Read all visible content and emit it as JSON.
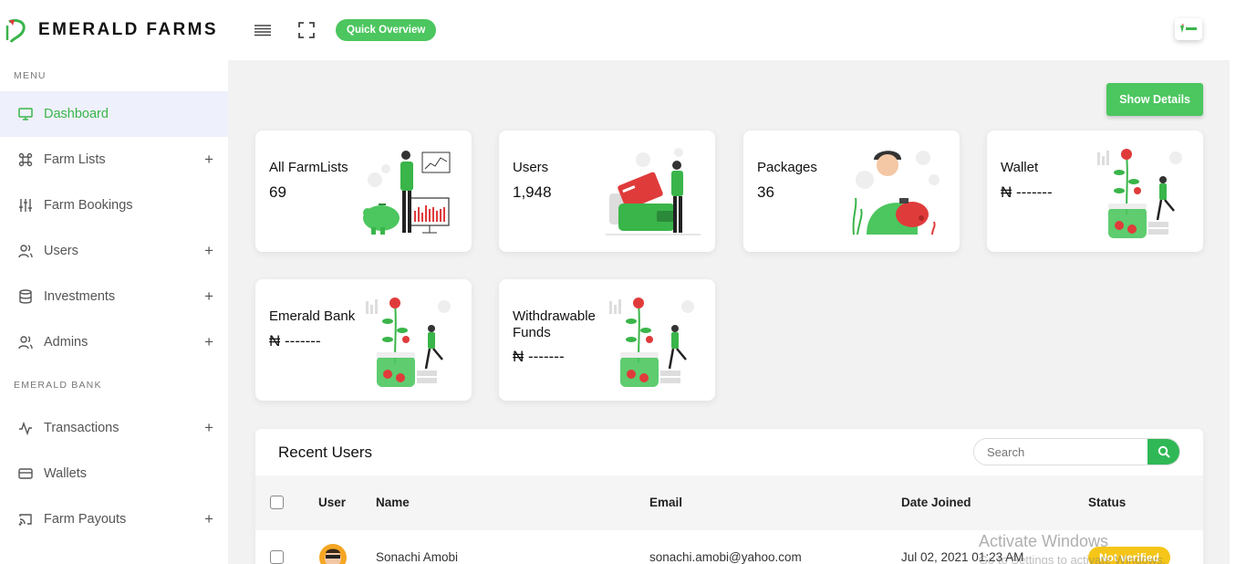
{
  "brand": {
    "name": "EMERALD FARMS"
  },
  "topbar": {
    "quick_overview": "Quick Overview"
  },
  "sidebar": {
    "menu_title": "MENU",
    "items": [
      {
        "label": "Dashboard",
        "icon": "monitor-icon",
        "active": true
      },
      {
        "label": "Farm Lists",
        "icon": "command-icon",
        "plus": "+"
      },
      {
        "label": "Farm Bookings",
        "icon": "sliders-icon"
      },
      {
        "label": "Users",
        "icon": "users-icon",
        "plus": "+"
      },
      {
        "label": "Investments",
        "icon": "database-icon",
        "plus": "+"
      },
      {
        "label": "Admins",
        "icon": "users-icon",
        "plus": "+"
      }
    ],
    "bank_title": "EMERALD BANK",
    "bank_items": [
      {
        "label": "Transactions",
        "icon": "activity-icon",
        "plus": "+"
      },
      {
        "label": "Wallets",
        "icon": "credit-card-icon"
      },
      {
        "label": "Farm Payouts",
        "icon": "cast-icon",
        "plus": "+"
      }
    ]
  },
  "main": {
    "show_details": "Show Details",
    "cards": [
      {
        "title": "All FarmLists",
        "value": "69"
      },
      {
        "title": "Users",
        "value": "1,948"
      },
      {
        "title": "Packages",
        "value": "36"
      },
      {
        "title": "Wallet",
        "value": "₦ -------"
      },
      {
        "title": "Emerald Bank",
        "value": "₦ -------"
      },
      {
        "title": "Withdrawable Funds",
        "value": "₦ -------"
      }
    ]
  },
  "recent_users": {
    "title": "Recent Users",
    "search_placeholder": "Search",
    "columns": [
      "User",
      "Name",
      "Email",
      "Date Joined",
      "Status"
    ],
    "rows": [
      {
        "name": "Sonachi Amobi",
        "email": "sonachi.amobi@yahoo.com",
        "date_joined": "Jul 02, 2021 01:23 AM",
        "status": "Not verified"
      }
    ]
  },
  "watermark": {
    "line1": "Activate Windows",
    "line2": "Go to Settings to activate Windows."
  },
  "colors": {
    "accent": "#4cc65f",
    "active_bg": "#eef0fb",
    "badge": "#f5c518",
    "search_btn": "#2fb855"
  }
}
